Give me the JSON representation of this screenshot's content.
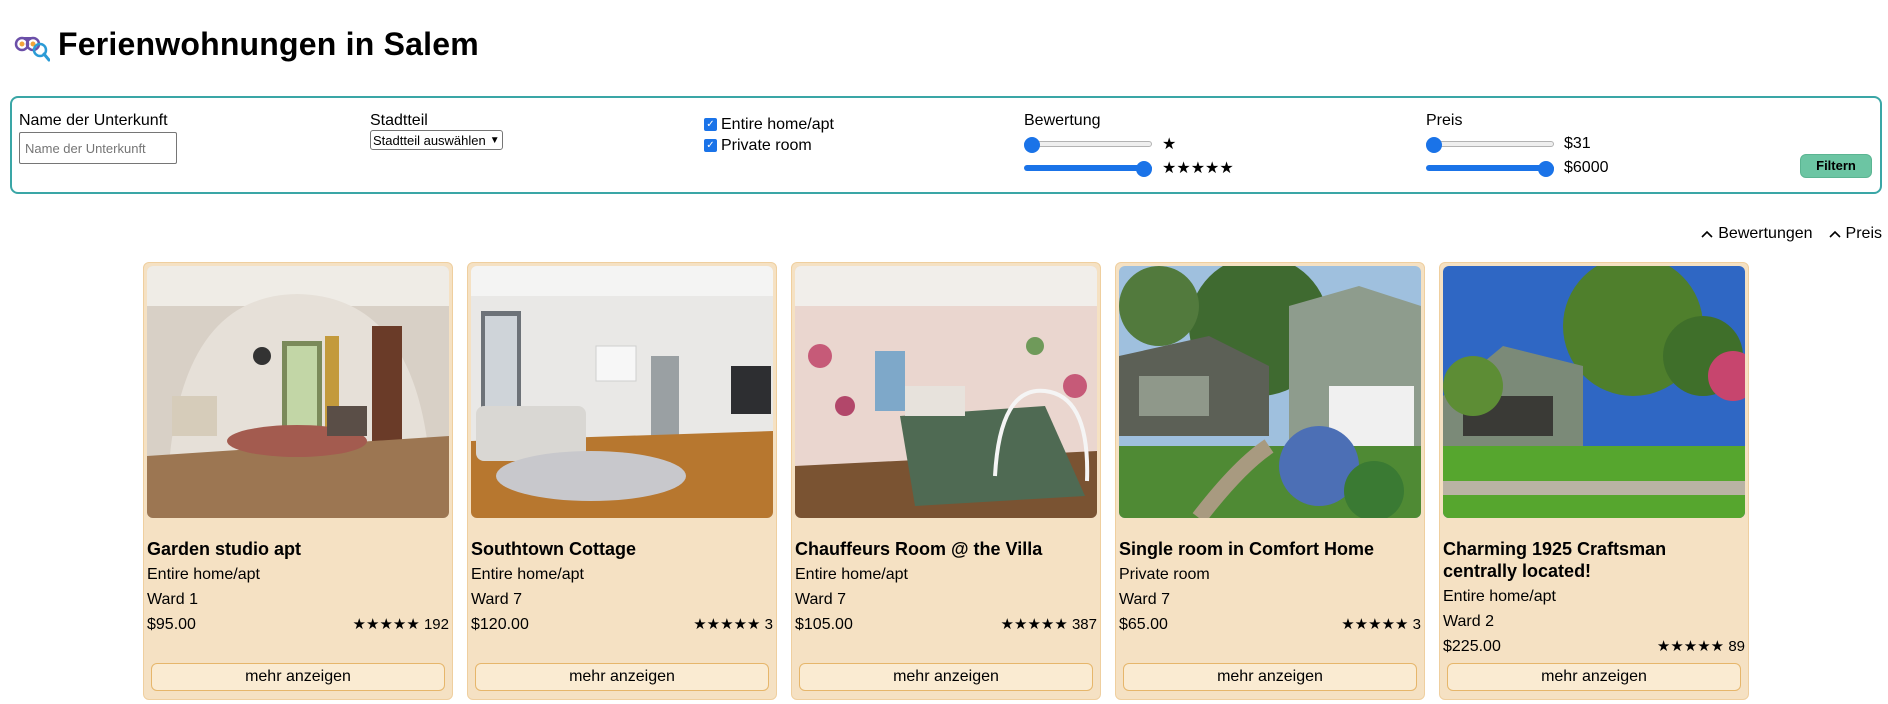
{
  "header": {
    "title": "Ferienwohnungen in Salem",
    "logo_icon": "binoculars-logo-icon"
  },
  "filters": {
    "name": {
      "label": "Name der Unterkunft",
      "placeholder": "Name der Unterkunft"
    },
    "district": {
      "label": "Stadtteil",
      "selected": "Stadtteil auswählen"
    },
    "room_types": [
      {
        "label": "Entire home/apt",
        "checked": true
      },
      {
        "label": "Private room",
        "checked": true
      }
    ],
    "rating": {
      "label": "Bewertung",
      "min_value": "★",
      "max_value": "★★★★★",
      "min_level": 0,
      "max_level": 1
    },
    "price": {
      "label": "Preis",
      "min_value": "$31",
      "max_value": "$6000",
      "min_level": 0,
      "max_level": 1
    },
    "submit_label": "Filtern",
    "accent_color": "#1a73e8"
  },
  "sort": {
    "rating_label": "Bewertungen",
    "price_label": "Preis"
  },
  "listings": [
    {
      "title": "Garden studio apt",
      "type": "Entire home/apt",
      "ward": "Ward 1",
      "price": "$95.00",
      "stars": "★★★★★",
      "reviews": "192",
      "button": "mehr anzeigen"
    },
    {
      "title": "Southtown Cottage",
      "type": "Entire home/apt",
      "ward": "Ward 7",
      "price": "$120.00",
      "stars": "★★★★★",
      "reviews": "3",
      "button": "mehr anzeigen"
    },
    {
      "title": "Chauffeurs Room @ the Villa",
      "type": "Entire home/apt",
      "ward": "Ward 7",
      "price": "$105.00",
      "stars": "★★★★★",
      "reviews": "387",
      "button": "mehr anzeigen"
    },
    {
      "title": "Single room in Comfort Home",
      "type": "Private room",
      "ward": "Ward 7",
      "price": "$65.00",
      "stars": "★★★★★",
      "reviews": "3",
      "button": "mehr anzeigen"
    },
    {
      "title": "Charming 1925 Craftsman centrally located!",
      "type": "Entire home/apt",
      "ward": "Ward 2",
      "price": "$225.00",
      "stars": "★★★★★",
      "reviews": "89",
      "button": "mehr anzeigen"
    }
  ]
}
